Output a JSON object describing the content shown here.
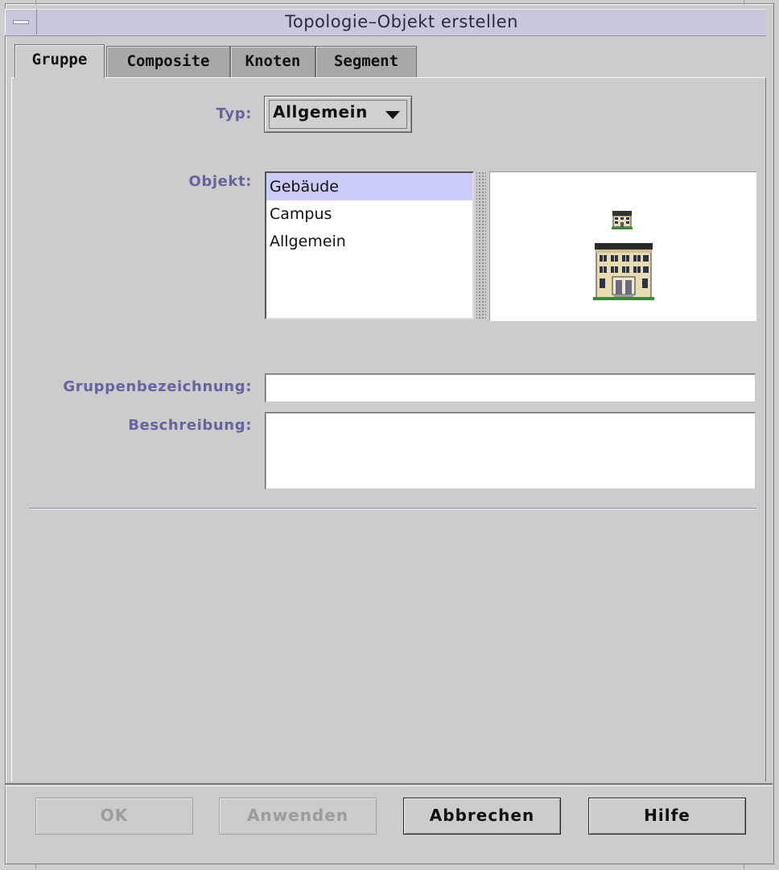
{
  "window": {
    "title": "Topologie–Objekt erstellen"
  },
  "tabs": [
    {
      "label": "Gruppe",
      "active": true
    },
    {
      "label": "Composite",
      "active": false
    },
    {
      "label": "Knoten",
      "active": false
    },
    {
      "label": "Segment",
      "active": false
    }
  ],
  "form": {
    "typ_label": "Typ:",
    "typ_value": "Allgemein",
    "objekt_label": "Objekt:",
    "objekt_items": [
      "Gebäude",
      "Campus",
      "Allgemein"
    ],
    "objekt_selected": "Gebäude",
    "preview_icon": "building-icon",
    "gruppenbezeichnung_label": "Gruppenbezeichnung:",
    "gruppenbezeichnung_value": "",
    "beschreibung_label": "Beschreibung:",
    "beschreibung_value": ""
  },
  "buttons": {
    "ok": "OK",
    "anwenden": "Anwenden",
    "abbrechen": "Abbrechen",
    "hilfe": "Hilfe"
  },
  "colors": {
    "titlebar": "#c8c8dc",
    "label": "#6464a0",
    "selection": "#ccccf8",
    "background": "#cccccc"
  }
}
